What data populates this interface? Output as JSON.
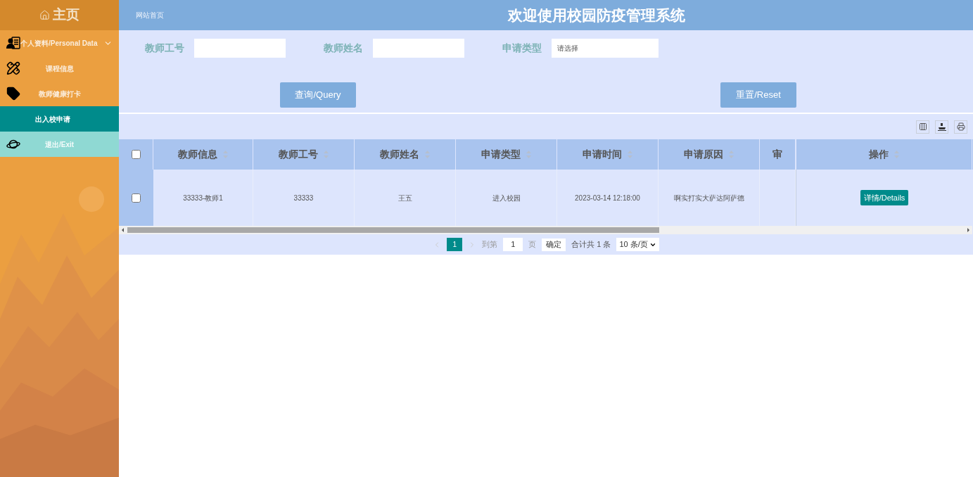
{
  "sidebar": {
    "title": "主页",
    "items": [
      {
        "label": "个人资料/Personal Data",
        "kind": "menu",
        "selected": false,
        "hovered": false
      },
      {
        "label": "课程信息",
        "kind": "link",
        "selected": false,
        "hovered": false
      },
      {
        "label": "教师健康打卡",
        "kind": "link",
        "selected": false,
        "hovered": false
      },
      {
        "label": "出入校申请",
        "kind": "link",
        "selected": true,
        "hovered": false
      },
      {
        "label": "退出/Exit",
        "kind": "link",
        "selected": false,
        "hovered": true
      }
    ]
  },
  "header": {
    "breadcrumb": "网站首页",
    "title": "欢迎使用校园防疫管理系统"
  },
  "search": {
    "fields": [
      {
        "label": "教师工号",
        "kind": "input"
      },
      {
        "label": "教师姓名",
        "kind": "input"
      },
      {
        "label": "申请类型",
        "kind": "select",
        "placeholder": "请选择"
      }
    ],
    "buttons": [
      "查询/Query",
      "重置/Reset"
    ]
  },
  "table": {
    "select_all": {
      "checked": false
    },
    "columns": [
      {
        "label": "教师信息",
        "sortable": true
      },
      {
        "label": "教师工号",
        "sortable": true
      },
      {
        "label": "教师姓名",
        "sortable": true
      },
      {
        "label": "申请类型",
        "sortable": true
      },
      {
        "label": "申请时间",
        "sortable": true
      },
      {
        "label": "申请原因",
        "sortable": true
      },
      {
        "label": "审",
        "sortable": false
      },
      {
        "label": "操作",
        "sortable": true
      }
    ],
    "rows": [
      {
        "checked": false,
        "cells": [
          "33333-教师1",
          "33333",
          "王五",
          "进入校园",
          "2023-03-14 12:18:00",
          "啊实打实大萨达阿萨德"
        ],
        "action": "详情/Details"
      }
    ]
  },
  "pagination": {
    "pages": [
      {
        "label": "1",
        "selected": true
      }
    ],
    "goto_label": "到第",
    "goto_value": "1",
    "page_unit": "页",
    "confirm": "确定",
    "total": "合计共 1 条",
    "page_size": "10 条/页"
  }
}
